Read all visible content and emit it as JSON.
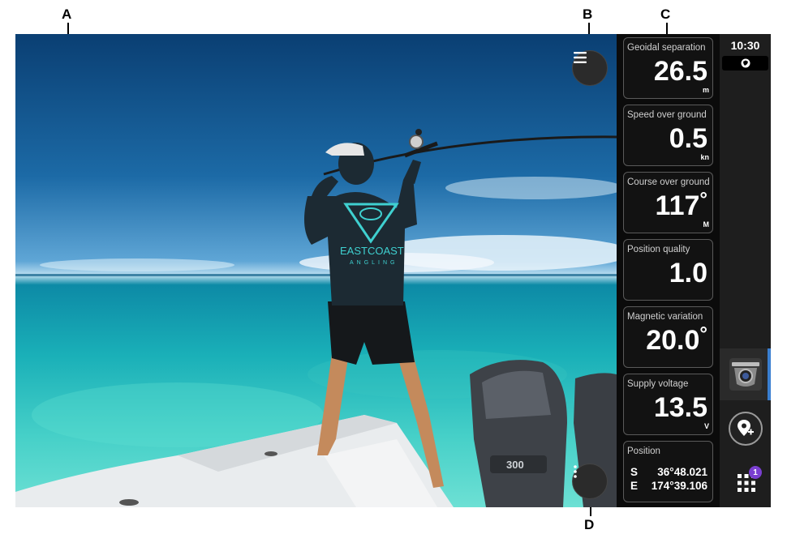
{
  "callouts": {
    "a": "A",
    "b": "B",
    "c": "C",
    "d": "D"
  },
  "shirt_text": {
    "line1": "EASTCOAST",
    "line2": "ANGLING"
  },
  "engine_text": "300",
  "tiles": [
    {
      "label": "Geoidal separation",
      "value": "26.5",
      "unit": "m",
      "degree": ""
    },
    {
      "label": "Speed over ground",
      "value": "0.5",
      "unit": "kn",
      "degree": ""
    },
    {
      "label": "Course over ground",
      "value": "117",
      "unit": "M",
      "degree": "°"
    },
    {
      "label": "Position quality",
      "value": "1.0",
      "unit": "",
      "degree": ""
    },
    {
      "label": "Magnetic variation",
      "value": "20.0",
      "unit": "",
      "degree": "°"
    },
    {
      "label": "Supply voltage",
      "value": "13.5",
      "unit": "V",
      "degree": ""
    }
  ],
  "position": {
    "label": "Position",
    "lat_hemi": "S",
    "lat": "36°48.021",
    "lon_hemi": "E",
    "lon": "174°39.106"
  },
  "sidebar": {
    "time": "10:30",
    "apps_badge": "1",
    "icons": [
      "gps-icon",
      "camera-icon",
      "add-waypoint-icon",
      "apps-grid-icon"
    ]
  },
  "buttons": {
    "menu": "menu-icon",
    "more": "more-vertical-icon"
  },
  "colors": {
    "panel": "#0b0b0b",
    "sidebar": "#1e1e1e",
    "accent": "#3a7fd0",
    "badge": "#7a3fd0"
  }
}
